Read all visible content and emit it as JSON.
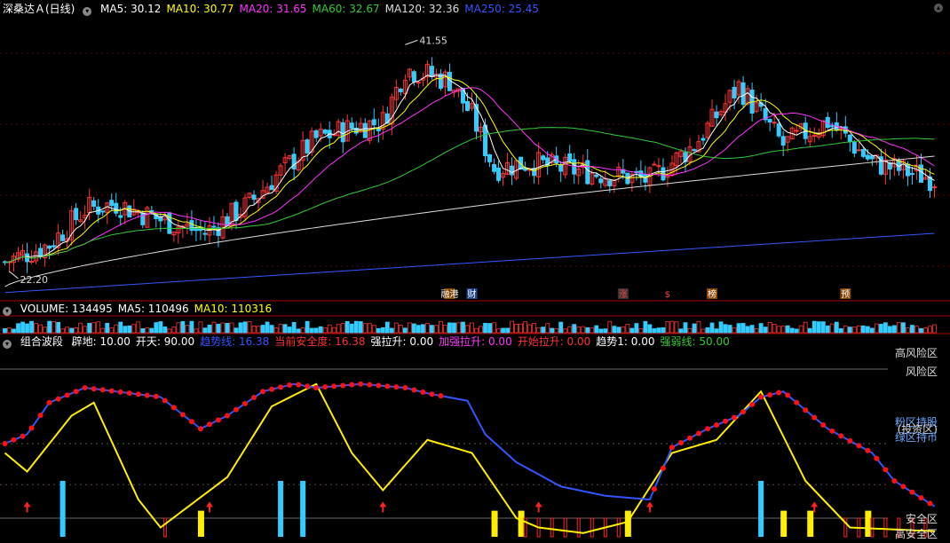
{
  "header": {
    "title": "深桑达Ａ(日线)",
    "ma": [
      {
        "label": "MA5: 30.12",
        "color": "#ffffff"
      },
      {
        "label": "MA10: 30.77",
        "color": "#ffff00"
      },
      {
        "label": "MA20: 31.65",
        "color": "#ff33ff"
      },
      {
        "label": "MA60: 32.67",
        "color": "#33cc33"
      },
      {
        "label": "MA120: 32.36",
        "color": "#dddddd"
      },
      {
        "label": "MA250: 25.45",
        "color": "#3355ff"
      }
    ],
    "max_label": "41.55",
    "min_label": "22.20"
  },
  "markers": [
    {
      "text": "融港",
      "color": "#ffffff",
      "bg": "#884400",
      "x_index": 100
    },
    {
      "text": "财",
      "color": "#ffffff",
      "bg": "#224488",
      "x_index": 105
    },
    {
      "text": "涨",
      "color": "#ff4444",
      "bg": "#333",
      "x_index": 139
    },
    {
      "text": "$",
      "color": "#ff4444",
      "bg": "#000",
      "x_index": 149
    },
    {
      "text": "榜",
      "color": "#ffffff",
      "bg": "#884400",
      "x_index": 159
    },
    {
      "text": "预",
      "color": "#ffffff",
      "bg": "#884400",
      "x_index": 189
    }
  ],
  "volume": {
    "items": [
      {
        "label": "VOLUME: 134495",
        "color": "#ffffff"
      },
      {
        "label": "MA5: 110496",
        "color": "#ffffff"
      },
      {
        "label": "MA10: 110316",
        "color": "#ffff00"
      }
    ]
  },
  "indicator": {
    "name": "组合波段",
    "items": [
      {
        "label": "辟地: 10.00",
        "color": "#ffffff"
      },
      {
        "label": "开天: 90.00",
        "color": "#ffffff"
      },
      {
        "label": "趋势线: 16.38",
        "color": "#3355ff"
      },
      {
        "label": "当前安全度: 16.38",
        "color": "#ff3333"
      },
      {
        "label": "强拉升: 0.00",
        "color": "#ffffff"
      },
      {
        "label": "加强拉升: 0.00",
        "color": "#ff33ff"
      },
      {
        "label": "开始拉升: 0.00",
        "color": "#ff3333"
      },
      {
        "label": "趋势1: 0.00",
        "color": "#ffffff"
      },
      {
        "label": "强弱线: 50.00",
        "color": "#33cc33"
      }
    ],
    "zones": [
      {
        "label": "高风险区",
        "color": "#dddddd",
        "y": 0.0
      },
      {
        "label": "风险区",
        "color": "#dddddd",
        "y": 0.1
      },
      {
        "label": "粉区持股",
        "color": "#66aaff",
        "y": 0.37
      },
      {
        "label": "(投资区)",
        "color": "#dddddd",
        "y": 0.41
      },
      {
        "label": "绿区持币",
        "color": "#66aaff",
        "y": 0.45
      },
      {
        "label": "安全区",
        "color": "#dddddd",
        "y": 0.89
      },
      {
        "label": "高安全区",
        "color": "#dddddd",
        "y": 0.97
      }
    ]
  },
  "chart_data": [
    {
      "type": "candlestick",
      "title": "深桑达Ａ(日线)",
      "ylim": [
        20,
        44
      ],
      "n": 210,
      "anchors_close": [
        [
          0,
          23
        ],
        [
          10,
          24.5
        ],
        [
          18,
          27.5
        ],
        [
          25,
          28
        ],
        [
          32,
          27
        ],
        [
          40,
          26
        ],
        [
          45,
          25.5
        ],
        [
          55,
          28
        ],
        [
          60,
          30
        ],
        [
          70,
          33.5
        ],
        [
          78,
          34.5
        ],
        [
          85,
          35
        ],
        [
          90,
          39.5
        ],
        [
          100,
          38.5
        ],
        [
          105,
          35.5
        ],
        [
          110,
          31
        ],
        [
          118,
          31.5
        ],
        [
          125,
          31
        ],
        [
          135,
          30.5
        ],
        [
          145,
          30
        ],
        [
          155,
          33
        ],
        [
          165,
          38
        ],
        [
          175,
          33
        ],
        [
          185,
          35
        ],
        [
          195,
          31.5
        ],
        [
          209,
          30.1
        ]
      ],
      "ma_lines": [
        {
          "name": "MA5",
          "value": 30.12,
          "color": "#ffffff"
        },
        {
          "name": "MA10",
          "value": 30.77,
          "color": "#ffff00"
        },
        {
          "name": "MA20",
          "value": 31.65,
          "color": "#ff33ff"
        },
        {
          "name": "MA60",
          "value": 32.67,
          "color": "#33cc33"
        },
        {
          "name": "MA120",
          "value": 32.36,
          "color": "#dddddd"
        },
        {
          "name": "MA250",
          "value": 25.45,
          "color": "#3355ff"
        }
      ],
      "max": {
        "value": 41.55,
        "x_index": 90
      },
      "min": {
        "value": 22.2,
        "x_index": 1
      }
    },
    {
      "type": "bar",
      "title": "VOLUME",
      "values_last": 134495,
      "ma5": 110496,
      "ma10": 110316
    },
    {
      "type": "line",
      "title": "组合波段",
      "ylim": [
        0,
        100
      ],
      "safety_anchors": [
        [
          0,
          50
        ],
        [
          5,
          55
        ],
        [
          10,
          72
        ],
        [
          18,
          80
        ],
        [
          25,
          78
        ],
        [
          35,
          75
        ],
        [
          44,
          58
        ],
        [
          50,
          65
        ],
        [
          58,
          78
        ],
        [
          65,
          82
        ],
        [
          70,
          80
        ],
        [
          80,
          82
        ],
        [
          90,
          80
        ],
        [
          95,
          77
        ],
        [
          104,
          73
        ],
        [
          108,
          55
        ],
        [
          115,
          40
        ],
        [
          125,
          27
        ],
        [
          135,
          22
        ],
        [
          145,
          20
        ],
        [
          150,
          48
        ],
        [
          158,
          58
        ],
        [
          165,
          65
        ],
        [
          170,
          75
        ],
        [
          175,
          78
        ],
        [
          180,
          68
        ],
        [
          185,
          58
        ],
        [
          195,
          45
        ],
        [
          200,
          30
        ],
        [
          209,
          16.38
        ]
      ],
      "trend_anchors": [
        [
          0,
          45
        ],
        [
          5,
          35
        ],
        [
          15,
          65
        ],
        [
          20,
          72
        ],
        [
          30,
          20
        ],
        [
          35,
          5
        ],
        [
          50,
          32
        ],
        [
          60,
          70
        ],
        [
          70,
          82
        ],
        [
          78,
          45
        ],
        [
          85,
          25
        ],
        [
          95,
          52
        ],
        [
          105,
          45
        ],
        [
          115,
          10
        ],
        [
          120,
          5
        ],
        [
          130,
          2
        ],
        [
          140,
          8
        ],
        [
          150,
          45
        ],
        [
          160,
          52
        ],
        [
          170,
          78
        ],
        [
          180,
          30
        ],
        [
          190,
          5
        ],
        [
          209,
          3
        ]
      ],
      "levels": {
        "pidi": 10,
        "kaitian": 90,
        "qiangruo": 50
      },
      "blue_spikes": [
        13,
        62,
        67,
        170
      ],
      "yellow_bars": [
        44,
        110,
        116,
        140,
        175,
        181,
        194
      ],
      "red_arrows": [
        5,
        46,
        85,
        120,
        145,
        182
      ]
    }
  ]
}
